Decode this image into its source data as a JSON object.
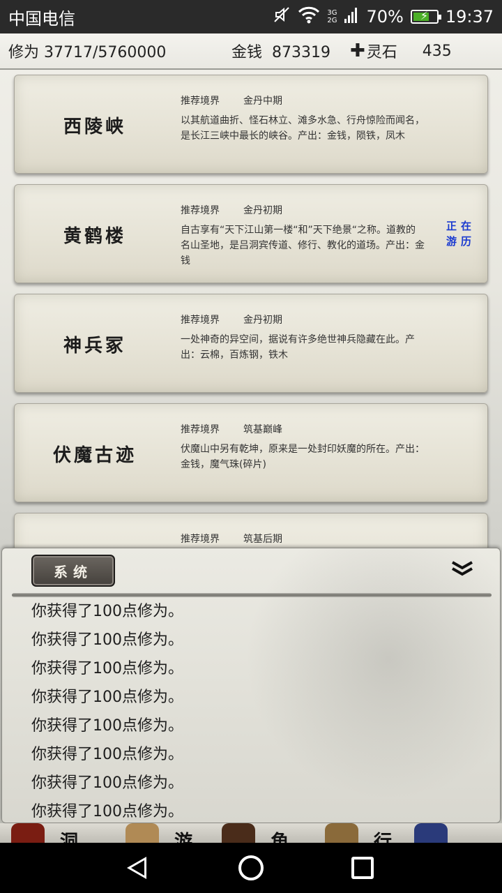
{
  "status_bar": {
    "carrier": "中国电信",
    "network_top": "3G",
    "network_bottom": "2G",
    "battery": "70%",
    "battery_level": 0.7,
    "time": "19:37"
  },
  "resources": {
    "cultivation_label": "修为",
    "cultivation_value": "37717/5760000",
    "money_label": "金钱",
    "money_value": "873319",
    "spirit_stone_label": "灵石",
    "spirit_stone_value": "435"
  },
  "locations": [
    {
      "name": "西陵峡",
      "realm_label": "推荐境界",
      "realm": "金丹中期",
      "description": "以其航道曲折、怪石林立、滩多水急、行舟惊险而闻名，是长江三峡中最长的峡谷。产出：金钱，陨铁，凤木",
      "status": ""
    },
    {
      "name": "黄鹤楼",
      "realm_label": "推荐境界",
      "realm": "金丹初期",
      "description": "自古享有“天下江山第一楼“和”天下绝景“之称。道教的名山圣地，是吕洞宾传道、修行、教化的道场。产出：金钱",
      "status": "正在游历"
    },
    {
      "name": "神兵冢",
      "realm_label": "推荐境界",
      "realm": "金丹初期",
      "description": "一处神奇的异空间，据说有许多绝世神兵隐藏在此。产出：云棉，百炼钢，铁木",
      "status": ""
    },
    {
      "name": "伏魔古迹",
      "realm_label": "推荐境界",
      "realm": "筑基巅峰",
      "description": "伏魔山中另有乾坤，原来是一处封印妖魔的所在。产出：金钱，魔气珠(碎片)",
      "status": ""
    },
    {
      "name": "",
      "realm_label": "推荐境界",
      "realm": "筑基后期",
      "description": "",
      "status": ""
    }
  ],
  "log_panel": {
    "tab_label": "系统",
    "collapse_icon": "chevron-double-down-icon",
    "lines": [
      "你获得了100点修为。",
      "你获得了100点修为。",
      "你获得了100点修为。",
      "你获得了100点修为。",
      "你获得了100点修为。",
      "你获得了100点修为。",
      "你获得了100点修为。",
      "你获得了100点修为。"
    ]
  },
  "game_nav": {
    "items": [
      {
        "label": "洞",
        "icon": "cave-icon",
        "color": "#7a1d12"
      },
      {
        "label": "游",
        "icon": "travel-icon",
        "color": "#b08a55"
      },
      {
        "label": "角",
        "icon": "character-icon",
        "color": "#4a2c1a"
      },
      {
        "label": "行",
        "icon": "action-icon",
        "color": "#8a6a3a"
      },
      {
        "label": "",
        "icon": "book-icon",
        "color": "#2a3a7a"
      }
    ]
  },
  "colors": {
    "status_text_blue": "#1a3ad0",
    "tab_bg": "#45413c",
    "card_bg": "#e6e3d6"
  }
}
